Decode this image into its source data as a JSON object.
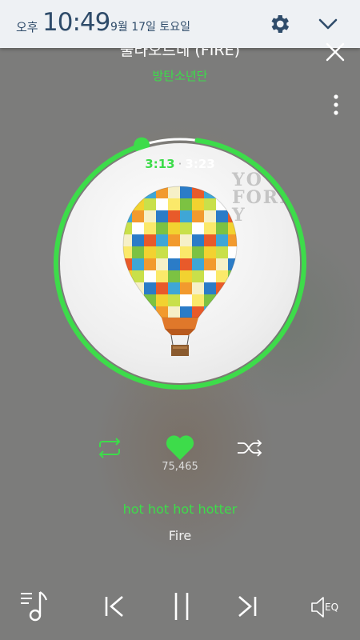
{
  "status_bar": {
    "ampm": "오후",
    "time": "10:49",
    "date": "9월 17일 토요일",
    "icons": [
      "gear-icon",
      "chevron-down-icon"
    ]
  },
  "player": {
    "song_title": "불타오르네 (FIRE)",
    "artist": "방탄소년단",
    "elapsed": "3:13",
    "separator": "·",
    "total": "3:23",
    "progress_fraction": 0.95,
    "album_art_text": "YO\nFORE\nY",
    "like_count": "75,465",
    "lyric_current": "hot hot hot hotter",
    "lyric_next": "Fire",
    "eq_label": "EQ"
  },
  "colors": {
    "accent": "#3ddc4a",
    "status_text": "#2f4c6a",
    "status_bg": "#eef1f4",
    "background": "#7c7c7b"
  },
  "icons": {
    "close": "close-icon",
    "more": "more-vertical-icon",
    "repeat": "repeat-icon",
    "heart": "heart-icon",
    "shuffle": "shuffle-icon",
    "playlist": "playlist-icon",
    "previous": "skip-previous-icon",
    "pause": "pause-icon",
    "next": "skip-next-icon",
    "equalizer": "speaker-eq-icon"
  }
}
